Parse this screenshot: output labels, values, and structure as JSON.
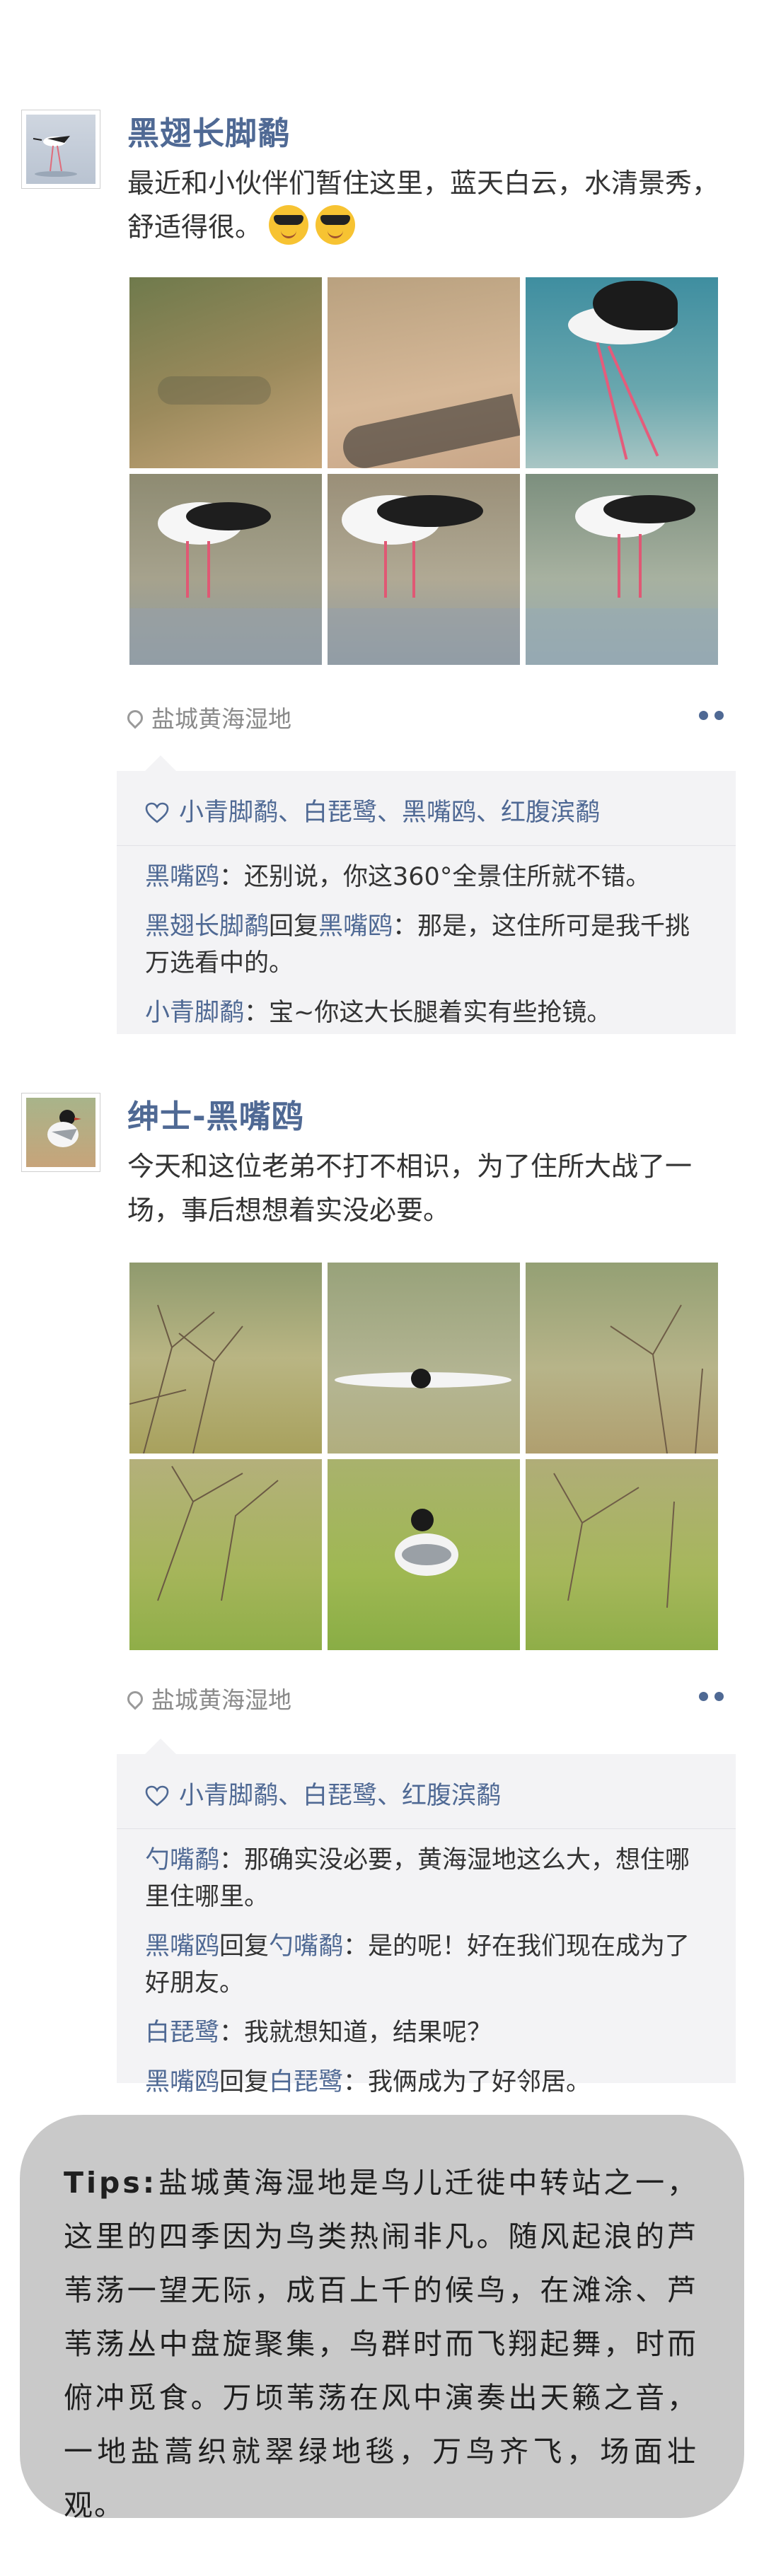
{
  "posts": [
    {
      "name": "黑翅长脚鹬",
      "text_line1": "最近和小伙伴们暂住这里，蓝天白云，水清景秀，",
      "text_line2": "舒适得很。",
      "location": "盐城黄海湿地",
      "likes": "小青脚鹬、白琵鹭、黑嘴鸥、红腹滨鹬",
      "comments": [
        {
          "user": "黑嘴鸥",
          "reply_to": "",
          "text": "：还别说，你这360°全景住所就不错。"
        },
        {
          "user": "黑翅长脚鹬",
          "reply_to": "黑嘴鸥",
          "text": "：那是，这住所可是我千挑万选看中的。"
        },
        {
          "user": "小青脚鹬",
          "reply_to": "",
          "text": "：宝~你这大长腿着实有些抢镜。"
        }
      ]
    },
    {
      "name": "绅士-黑嘴鸥",
      "text_line1": "今天和这位老弟不打不相识，为了住所大战了一",
      "text_line2": "场，事后想想着实没必要。",
      "location": "盐城黄海湿地",
      "likes": "小青脚鹬、白琵鹭、红腹滨鹬",
      "comments": [
        {
          "user": "勺嘴鹬",
          "reply_to": "",
          "text": "：那确实没必要，黄海湿地这么大，想住哪里住哪里。"
        },
        {
          "user": "黑嘴鸥",
          "reply_to": "勺嘴鹬",
          "text": "：是的呢！好在我们现在成为了好朋友。"
        },
        {
          "user": "白琵鹭",
          "reply_to": "",
          "text": "：我就想知道，结果呢？"
        },
        {
          "user": "黑嘴鸥",
          "reply_to": "白琵鹭",
          "text": "：我俩成为了好邻居。"
        }
      ]
    }
  ],
  "reply_word": "回复",
  "tips_label": "Tips:",
  "tips_text": "盐城黄海湿地是鸟儿迁徙中转站之一，这里的四季因为鸟类热闹非凡。随风起浪的芦苇荡一望无际，成百上千的候鸟，在滩涂、芦苇荡丛中盘旋聚集，鸟群时而飞翔起舞，时而俯冲觅食。万顷苇荡在风中演奏出天籁之音，一地盐蒿织就翠绿地毯，万鸟齐飞，场面壮观。",
  "colors": {
    "name": "#4f6994",
    "comment_bg": "#f3f3f5",
    "tips_bg": "#c9c9c9"
  }
}
